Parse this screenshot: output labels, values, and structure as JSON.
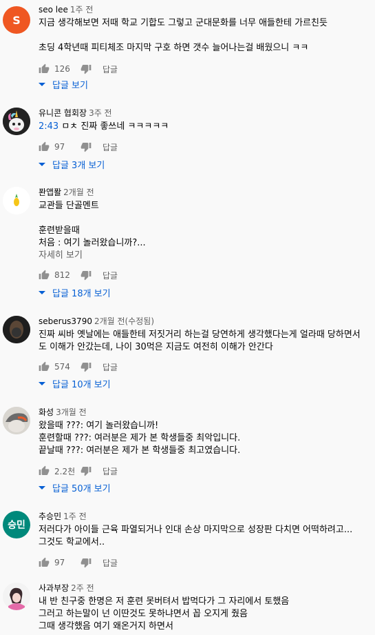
{
  "comments": [
    {
      "author": "seo lee",
      "time": "1주 전",
      "avatar": {
        "type": "letter",
        "letter": "S",
        "color": "#ef5722"
      },
      "lines": [
        "지금 생각해보면 저때 학교 기합도 그렇고 군대문화를 너무 애들한테 가르친듯",
        "",
        "초딩 4학년때 피티체조 마지막 구호 하면 갯수 늘어나는걸 배웠으니 ㅋㅋ"
      ],
      "likes": "126",
      "reply_label": "답글",
      "replies_label": "답글 보기"
    },
    {
      "author": "유니콘 협회장",
      "time": "3주 전",
      "avatar": {
        "type": "unicorn"
      },
      "timestamp_link": "2:43",
      "lines": [
        "ㅁㅊ 진짜 좋쓰네 ㅋㅋㅋㅋㅋ"
      ],
      "likes": "97",
      "reply_label": "답글",
      "replies_label": "답글 3개 보기"
    },
    {
      "author": "퐌앱퐐",
      "time": "2개월 전",
      "avatar": {
        "type": "pineapple"
      },
      "lines": [
        "교관들 단골멘트",
        "",
        "훈련받을때",
        "처음 : 여기 놀러왔습니까?..."
      ],
      "read_more": "자세히 보기",
      "likes": "812",
      "reply_label": "답글",
      "replies_label": "답글 18개 보기"
    },
    {
      "author": "seberus3790",
      "time": "2개월 전(수정됨)",
      "avatar": {
        "type": "dark"
      },
      "lines": [
        "진짜 씨바 옛날에는 애들한테 저짓거리 하는걸 당연하게 생각했다는게 얼라때 당하면서",
        "도 이해가 안갔는데, 나이 30먹은 지금도 여전히 이해가 안간다"
      ],
      "likes": "574",
      "reply_label": "답글",
      "replies_label": "답글 10개 보기"
    },
    {
      "author": "화성",
      "time": "3개월 전",
      "avatar": {
        "type": "photo"
      },
      "lines": [
        "왔을때 ???: 여기 놀러왔습니까!",
        "훈련할때 ???: 여러분은 제가 본 학생들중 최악입니다.",
        "끝날때 ???: 여러분은 제가 본 학생들중 최고였습니다."
      ],
      "likes": "2.2천",
      "reply_label": "답글",
      "replies_label": "답글 50개 보기"
    },
    {
      "author": "추승민",
      "time": "1주 전",
      "avatar": {
        "type": "letter",
        "letter": "승민",
        "color": "#00897b"
      },
      "lines": [
        "저러다가 아이들 근육 파열되거나 인대 손상  마지막으로 성장판 다치면 어떡하려고...",
        "그것도 학교에서.."
      ],
      "likes": "97",
      "reply_label": "답글"
    },
    {
      "author": "사과부장",
      "time": "2주 전",
      "avatar": {
        "type": "anime"
      },
      "lines": [
        "내 반 친구중 한명은 저 훈련 못버텨서 밥먹다가 그 자리에서 토했음",
        "그러고 하는말이 넌 이딴것도 못하냐면서 꼽 오지게 줬음",
        "그때 생각했음 여기 왜온거지 하면서"
      ]
    }
  ]
}
